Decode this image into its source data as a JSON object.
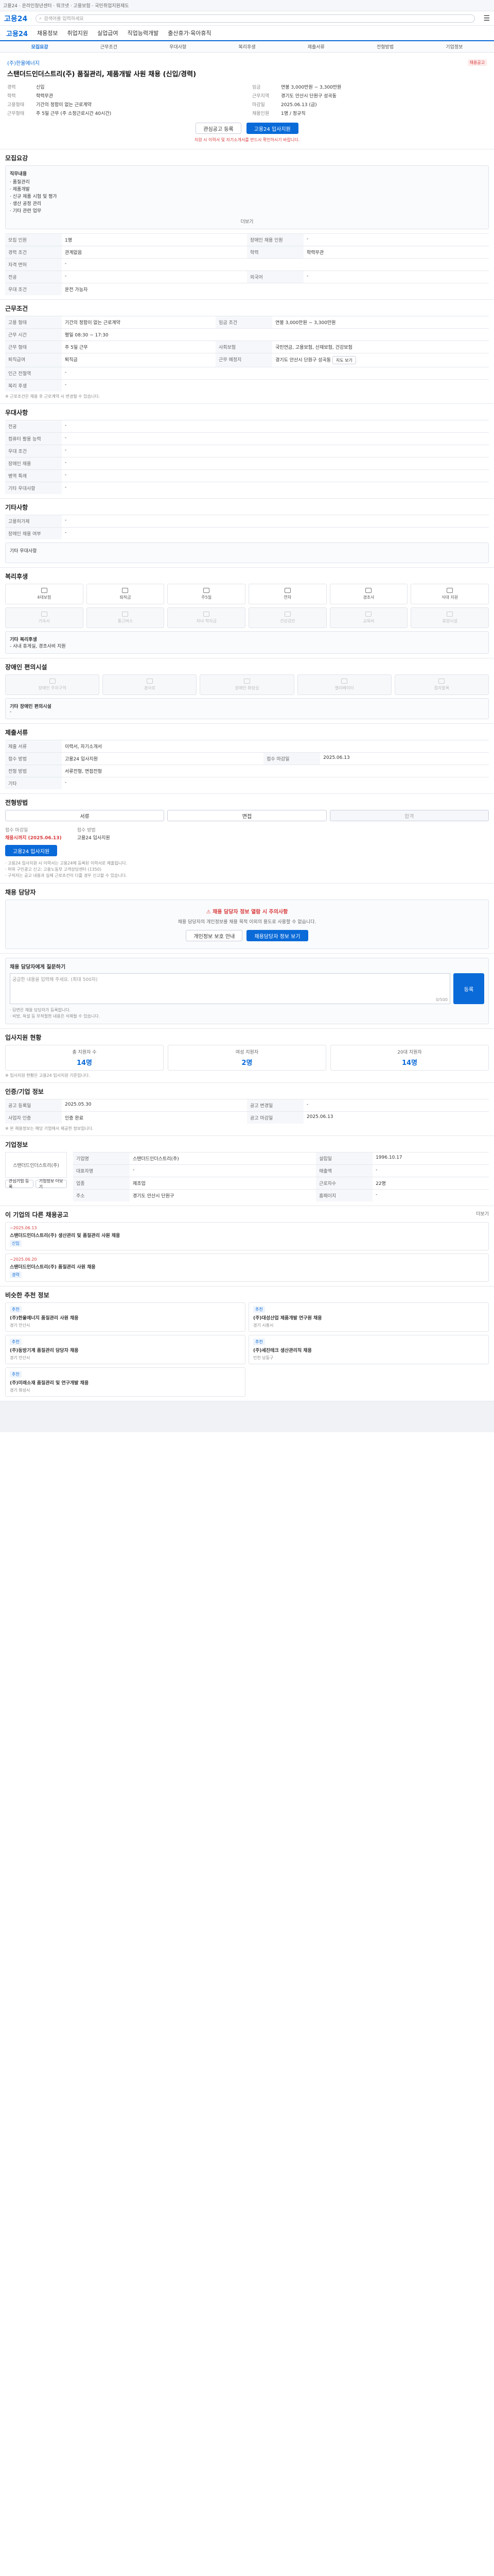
{
  "topbar": {
    "text": "고용24 · 온라인청년센터 · 워크넷 · 고용보험 · 국민취업지원제도"
  },
  "header": {
    "logo": "고용24",
    "search_placeholder": "검색어를 입력하세요"
  },
  "nav": {
    "home": "고용24",
    "items": [
      "채용정보",
      "취업지원",
      "실업급여",
      "직업능력개발",
      "출산휴가·육아휴직"
    ]
  },
  "tabs": [
    "모집요강",
    "근무조건",
    "우대사항",
    "복리후생",
    "제출서류",
    "전형방법",
    "기업정보"
  ],
  "job": {
    "company": "(주)한울에너지",
    "title": "스탠더드인더스트리(주) 품질관리, 제품개발 사원 채용 (신입/경력)",
    "badge": "채용공고",
    "summary_left": [
      {
        "k": "경력",
        "v": "신입"
      },
      {
        "k": "학력",
        "v": "학력무관"
      },
      {
        "k": "고용형태",
        "v": "기간의 정함이 없는 근로계약"
      },
      {
        "k": "근무형태",
        "v": "주 5일 근무 (주 소정근로시간 40시간)"
      }
    ],
    "summary_right": [
      {
        "k": "임금",
        "v": "연봉 3,000만원 ~ 3,300만원"
      },
      {
        "k": "근무지역",
        "v": "경기도 안산시 단원구 성곡동"
      },
      {
        "k": "마감일",
        "v": "2025.06.13 (금)"
      },
      {
        "k": "채용인원",
        "v": "1명 / 정규직"
      }
    ],
    "btn_scrap": "관심공고 등록",
    "btn_apply": "고용24 입사지원",
    "notice": "지원 시 이력서 및 자기소개서를 반드시 확인하시기 바랍니다."
  },
  "sections": {
    "recruit": {
      "title": "모집요강",
      "duty_label": "직무내용",
      "duty": [
        "· 품질관리",
        "· 제품개발",
        "· 신규 제품 시험 및 평가",
        "· 생산 공정 관리",
        "· 기타 관련 업무"
      ],
      "more": "더보기",
      "rows": [
        {
          "k": "모집 인원",
          "v": "1명",
          "k2": "장애인 채용 인원",
          "v2": "-"
        },
        {
          "k": "경력 조건",
          "v": "관계없음",
          "k2": "학력",
          "v2": "학력무관"
        },
        {
          "k": "자격 면허",
          "v": "-",
          "k2": "",
          "v2": ""
        },
        {
          "k": "전공",
          "v": "-",
          "k2": "외국어",
          "v2": "-"
        },
        {
          "k": "우대 조건",
          "v": "운전 가능자",
          "k2": "",
          "v2": ""
        }
      ]
    },
    "work": {
      "title": "근무조건",
      "rows": [
        {
          "k": "고용 형태",
          "v": "기간의 정함이 없는 근로계약",
          "k2": "임금 조건",
          "v2": "연봉 3,000만원 ~ 3,300만원"
        },
        {
          "k": "근무 시간",
          "v": "평일 08:30 ~ 17:30",
          "k2": "",
          "v2": ""
        },
        {
          "k": "근무 형태",
          "v": "주 5일 근무",
          "k2": "사회보험",
          "v2": "국민연금, 고용보험, 산재보험, 건강보험"
        },
        {
          "k": "퇴직급여",
          "v": "퇴직금",
          "k2": "근무 예정지",
          "v2": "경기도 안산시 단원구 성곡동"
        },
        {
          "k": "인근 전철역",
          "v": "-",
          "k2": "",
          "v2": ""
        },
        {
          "k": "복리 후생",
          "v": "-",
          "k2": "",
          "v2": ""
        }
      ],
      "note": "※ 근로조건은 채용 후 근로계약 시 변경될 수 있습니다.",
      "map_btn": "지도 보기"
    },
    "prefer": {
      "title": "우대사항",
      "rows": [
        {
          "k": "전공",
          "v": "-"
        },
        {
          "k": "컴퓨터 활용 능력",
          "v": "-"
        },
        {
          "k": "우대 조건",
          "v": "-"
        },
        {
          "k": "장애인 채용",
          "v": "-"
        },
        {
          "k": "병역 특례",
          "v": "-"
        },
        {
          "k": "기타 우대사항",
          "v": "-"
        }
      ]
    },
    "etc": {
      "title": "기타사항",
      "rows": [
        {
          "k": "고용허가제",
          "v": "-"
        },
        {
          "k": "장애인 채용 여부",
          "v": "-"
        }
      ],
      "note": "기타 우대사항"
    },
    "welfare": {
      "title": "복리후생",
      "items_on": [
        "4대보험",
        "퇴직금",
        "주5일",
        "연차",
        "경조사",
        "식대 지원"
      ],
      "items_off": [
        "기숙사",
        "통근버스",
        "자녀 학자금",
        "건강검진",
        "교육비",
        "휴양시설"
      ],
      "note_title": "기타 복리후생",
      "note": "- 사내 휴게실, 경조사비 지원"
    },
    "disability": {
      "title": "장애인 편의시설",
      "items": [
        "장애인 주차구역",
        "경사로",
        "장애인 화장실",
        "엘리베이터",
        "점자블록"
      ],
      "note_title": "기타 장애인 편의시설",
      "note": "-"
    },
    "docs": {
      "title": "제출서류",
      "rows": [
        {
          "k": "제출 서류",
          "v": "이력서, 자기소개서",
          "k2": "",
          "v2": ""
        },
        {
          "k": "접수 방법",
          "v": "고용24 입사지원",
          "k2": "접수 마감일",
          "v2": "2025.06.13"
        },
        {
          "k": "전형 방법",
          "v": "서류전형, 면접전형",
          "k2": "",
          "v2": ""
        },
        {
          "k": "기타",
          "v": "-",
          "k2": "",
          "v2": ""
        }
      ]
    },
    "process": {
      "title": "전형방법",
      "steps": [
        "서류",
        "면접",
        "합격"
      ],
      "apply_title": "접수 마감일",
      "apply_value": "채용시까지 (2025.06.13)",
      "method_title": "접수 방법",
      "method_value": "고용24 입사지원",
      "apply_btn": "고용24 입사지원",
      "notes": [
        "· 고용24 입사지원 시 이력서는 고용24에 등록된 이력서로 제출됩니다.",
        "· 허위 구인광고 신고: 고용노동부 고객상담센터 (1350)",
        "· 구직자는 공고 내용과 실제 근로조건이 다를 경우 신고할 수 있습니다."
      ]
    },
    "contact": {
      "title": "채용 담당자",
      "headline": "채용 담당자 정보 열람 시 주의사항",
      "desc": "채용 담당자의 개인정보를 채용 목적 이외의 용도로 사용할 수 없습니다.",
      "btn_view": "채용담당자 정보 보기",
      "btn_info": "개인정보 보호 안내"
    },
    "qna": {
      "title": "채용 담당자에게 질문하기",
      "placeholder": "궁금한 내용을 입력해 주세요. (최대 500자)",
      "count": "0/500",
      "submit": "등록",
      "notes": [
        "· 답변은 채용 담당자가 등록합니다.",
        "· 비방, 욕설 등 부적절한 내용은 삭제될 수 있습니다."
      ]
    },
    "stats": {
      "title": "입사지원 현황",
      "items": [
        {
          "l": "총 지원자 수",
          "n": "14명"
        },
        {
          "l": "여성 지원자",
          "n": "2명"
        },
        {
          "l": "20대 지원자",
          "n": "14명"
        }
      ],
      "note": "※ 입사지원 현황은 고용24 입사지원 기준입니다."
    },
    "manage": {
      "title": "인증/기업 정보",
      "rows": [
        {
          "k": "공고 등록일",
          "v": "2025.05.30",
          "k2": "공고 변경일",
          "v2": "-"
        },
        {
          "k": "사업자 인증",
          "v": "인증 완료",
          "k2": "공고 마감일",
          "v2": "2025.06.13"
        }
      ],
      "note": "※ 본 채용정보는 해당 기업에서 제공한 정보입니다."
    },
    "company": {
      "title": "기업정보",
      "name": "스탠더드인더스트리(주)",
      "rows": [
        {
          "k": "기업명",
          "v": "스탠더드인더스트리(주)",
          "k2": "설립일",
          "v2": "1996.10.17"
        },
        {
          "k": "대표자명",
          "v": "-",
          "k2": "매출액",
          "v2": "-"
        },
        {
          "k": "업종",
          "v": "제조업",
          "k2": "근로자수",
          "v2": "22명"
        },
        {
          "k": "주소",
          "v": "경기도 안산시 단원구",
          "k2": "홈페이지",
          "v2": "-"
        }
      ],
      "btn_follow": "관심기업 등록",
      "btn_more": "기업정보 더보기"
    },
    "others": {
      "title": "이 기업의 다른 채용공고",
      "more": "더보기",
      "cards": [
        {
          "date": "~2025.06.13",
          "title": "스탠더드인더스트리(주) 생산관리 및 품질관리 사원 채용",
          "tag": "신입"
        },
        {
          "date": "~2025.06.20",
          "title": "스탠더드인더스트리(주) 품질관리 사원 채용",
          "tag": "경력"
        }
      ]
    },
    "similar": {
      "title": "비슷한 추천 정보",
      "cards": [
        {
          "tag": "추천",
          "title": "(주)한울에너지 품질관리 사원 채용",
          "loc": "경기 안산시"
        },
        {
          "tag": "추천",
          "title": "(주)대성산업 제품개발 연구원 채용",
          "loc": "경기 시흥시"
        },
        {
          "tag": "추천",
          "title": "(주)동방기계 품질관리 담당자 채용",
          "loc": "경기 안산시"
        },
        {
          "tag": "추천",
          "title": "(주)세진테크 생산관리직 채용",
          "loc": "인천 남동구"
        },
        {
          "tag": "추천",
          "title": "(주)미래소재 품질관리 및 연구개발 채용",
          "loc": "경기 화성시"
        }
      ]
    }
  }
}
